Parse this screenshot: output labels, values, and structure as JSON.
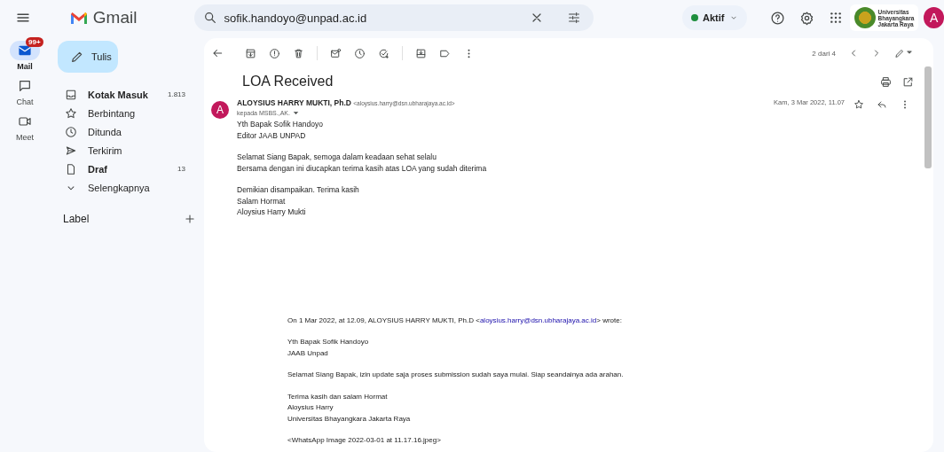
{
  "header": {
    "product": "Gmail",
    "search": {
      "value": "sofik.handoyo@unpad.ac.id"
    },
    "status": "Aktif",
    "org_logo": [
      "Universitas",
      "Bhayangkara",
      "Jakarta Raya"
    ],
    "avatar": "A"
  },
  "rail": [
    {
      "label": "Mail",
      "selected": true,
      "badge": "99+"
    },
    {
      "label": "Chat",
      "selected": false
    },
    {
      "label": "Meet",
      "selected": false
    }
  ],
  "compose": "Tulis",
  "folders": [
    {
      "label": "Kotak Masuk",
      "count": "1.813",
      "unread": true
    },
    {
      "label": "Berbintang",
      "unread": false
    },
    {
      "label": "Ditunda",
      "unread": false
    },
    {
      "label": "Terkirim",
      "unread": false
    },
    {
      "label": "Draf",
      "count": "13",
      "unread": true
    },
    {
      "label": "Selengkapnya",
      "unread": false
    }
  ],
  "labels_heading": "Label",
  "email": {
    "pager": "2 dari 4",
    "subject": "LOA Received",
    "sender": {
      "name": "ALOYSIUS HARRY MUKTI, Ph.D",
      "address": "<aloysius.harry@dsn.ubharajaya.ac.id>",
      "initial": "A"
    },
    "recipient": "kepada MSBS.,AK.",
    "date": "Kam, 3 Mar 2022, 11.07",
    "body": [
      [
        "Yth Bapak Sofik Handoyo",
        "Editor JAAB UNPAD"
      ],
      [
        "Selamat Siang Bapak, semoga dalam keadaan sehat selalu",
        "Bersama dengan ini diucapkan terima kasih atas LOA yang sudah diterima"
      ],
      [
        "Demikian disampaikan. Terima kasih",
        "Salam Hormat",
        "Aloysius Harry Mukti"
      ]
    ],
    "quote": {
      "header_before": "On 1 Mar 2022, at 12.09, ALOYSIUS HARRY MUKTI, Ph.D <",
      "link": "aloysius.harry@dsn.ubharajaya.ac.id",
      "header_after": "> wrote:",
      "body": [
        [
          "Yth Bapak Sofik Handoyo",
          "JAAB Unpad"
        ],
        [
          "Selamat Siang Bapak, izin update saja proses submission sudah saya mulai. Siap seandainya ada arahan."
        ],
        [
          "Terima kasih dan salam Hormat",
          "Aloysius Harry",
          "Universitas Bhayangkara Jakarta Raya"
        ],
        [
          "<WhatsApp Image 2022-03-01 at 11.17.16.jpeg>"
        ]
      ]
    }
  }
}
